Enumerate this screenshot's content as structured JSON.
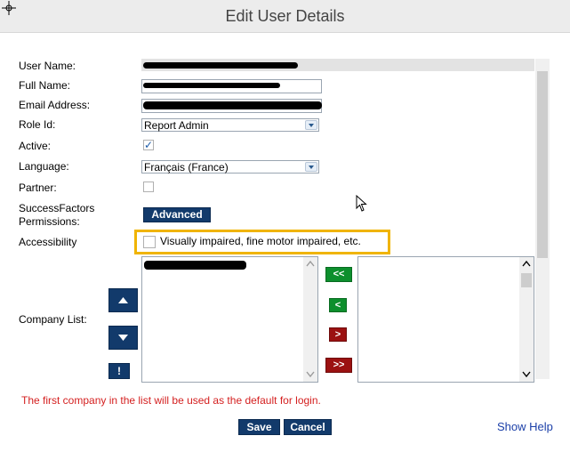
{
  "window": {
    "title": "Edit User Details"
  },
  "form": {
    "user_name_label": "User Name:",
    "full_name_label": "Full Name:",
    "email_label": "Email Address:",
    "role_label": "Role Id:",
    "role_value": "Report Admin",
    "active_label": "Active:",
    "active_checked": "✓",
    "language_label": "Language:",
    "language_value": "Français (France)",
    "partner_label": "Partner:",
    "sf_label_1": "SuccessFactors",
    "sf_label_2": "Permissions:",
    "advanced_button": "Advanced",
    "accessibility_label": "Accessibility",
    "accessibility_option": "Visually impaired, fine motor impaired, etc.",
    "company_list_label": "Company List:",
    "move_all_left": "<<",
    "move_left": "<",
    "move_right": ">",
    "move_all_right": ">>",
    "exclaim": "!",
    "note": "The first company in the list will be used as the default for login."
  },
  "actions": {
    "save": "Save",
    "cancel": "Cancel",
    "help": "Show Help"
  },
  "colors": {
    "highlight": "#f0b400",
    "navy": "#123a6b",
    "green": "#0d8f2d",
    "red": "#9b1111",
    "note": "#d41f1f"
  }
}
